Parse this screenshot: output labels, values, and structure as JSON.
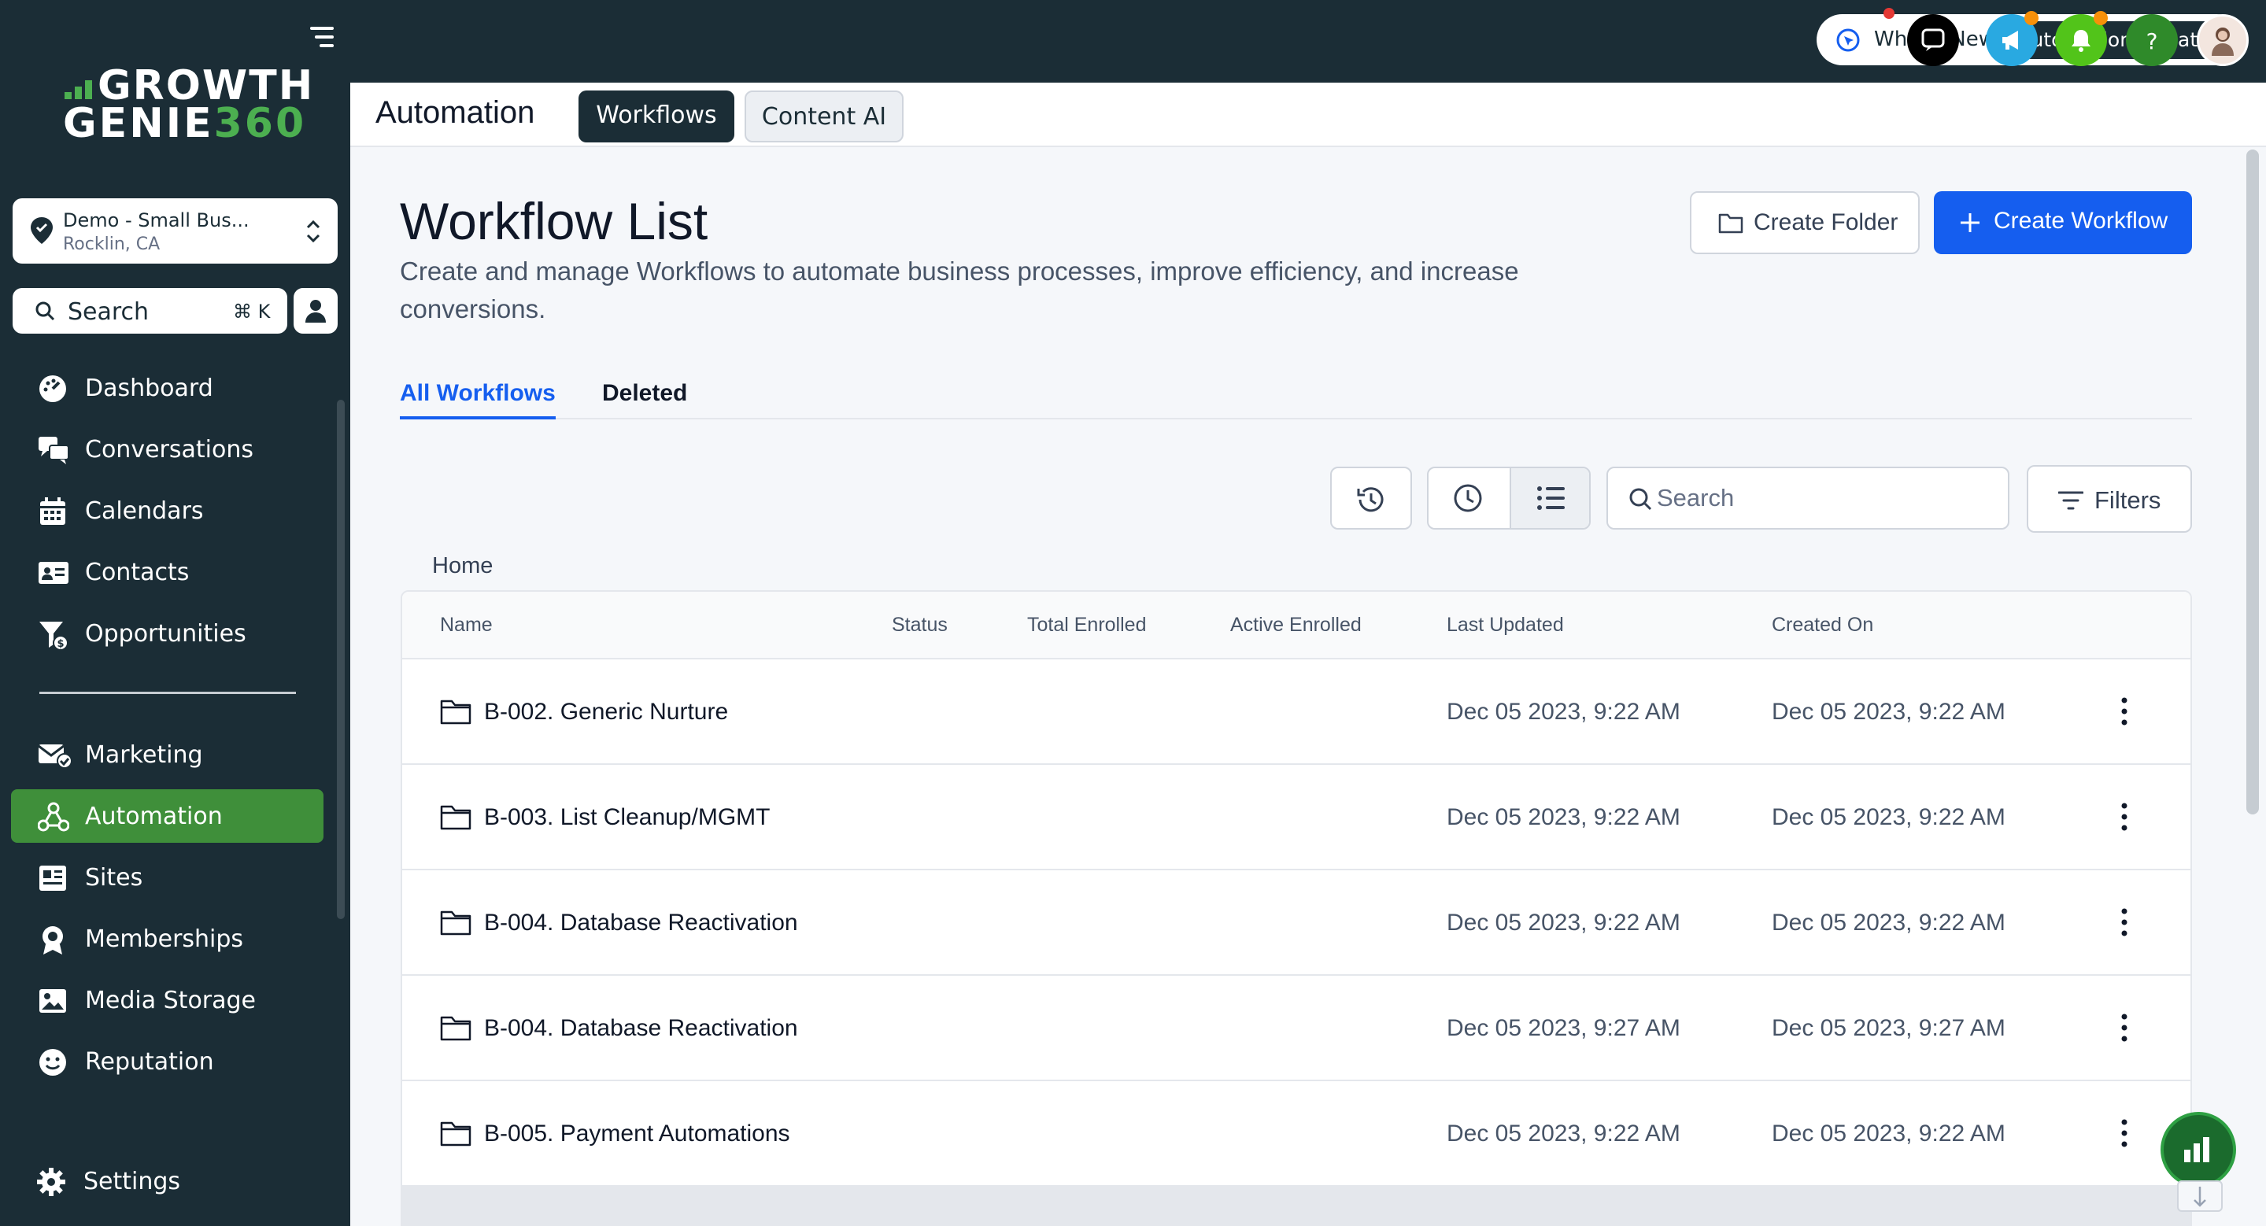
{
  "sidebar": {
    "logo": {
      "line1": "GROWTH",
      "line2a": "GENIE",
      "line2b": "360"
    },
    "location": {
      "name": "Demo - Small Bus...",
      "city": "Rocklin, CA"
    },
    "search": {
      "label": "Search",
      "shortcut": "⌘ K"
    },
    "items": [
      {
        "label": "Dashboard",
        "icon": "dashboard-icon"
      },
      {
        "label": "Conversations",
        "icon": "chat-icon"
      },
      {
        "label": "Calendars",
        "icon": "calendar-icon"
      },
      {
        "label": "Contacts",
        "icon": "contact-card-icon"
      },
      {
        "label": "Opportunities",
        "icon": "funnel-icon"
      },
      {
        "label": "Marketing",
        "icon": "mail-check-icon"
      },
      {
        "label": "Automation",
        "icon": "workflow-icon",
        "active": true
      },
      {
        "label": "Sites",
        "icon": "sites-icon"
      },
      {
        "label": "Memberships",
        "icon": "badge-icon"
      },
      {
        "label": "Media Storage",
        "icon": "image-icon"
      },
      {
        "label": "Reputation",
        "icon": "smiley-icon"
      },
      {
        "label": "Settings",
        "icon": "gear-icon"
      }
    ]
  },
  "topbar": {
    "whats_new": "What's New",
    "automation_updates": "Automation Updates"
  },
  "subheader": {
    "title": "Automation",
    "tabs": [
      {
        "label": "Workflows",
        "active": true
      },
      {
        "label": "Content AI",
        "active": false
      }
    ]
  },
  "page": {
    "title": "Workflow List",
    "description": "Create and manage Workflows to automate business processes, improve efficiency, and increase conversions.",
    "create_folder": "Create Folder",
    "create_workflow": "Create Workflow",
    "tabs": [
      {
        "label": "All Workflows",
        "selected": true
      },
      {
        "label": "Deleted",
        "selected": false
      }
    ],
    "search_placeholder": "Search",
    "filters": "Filters",
    "breadcrumb": "Home"
  },
  "table": {
    "columns": [
      "Name",
      "Status",
      "Total Enrolled",
      "Active Enrolled",
      "Last Updated",
      "Created On"
    ],
    "rows": [
      {
        "name": "B-002. Generic Nurture",
        "last_updated": "Dec 05 2023, 9:22 AM",
        "created_on": "Dec 05 2023, 9:22 AM"
      },
      {
        "name": "B-003. List Cleanup/MGMT",
        "last_updated": "Dec 05 2023, 9:22 AM",
        "created_on": "Dec 05 2023, 9:22 AM"
      },
      {
        "name": "B-004. Database Reactivation",
        "last_updated": "Dec 05 2023, 9:22 AM",
        "created_on": "Dec 05 2023, 9:22 AM"
      },
      {
        "name": "B-004. Database Reactivation",
        "last_updated": "Dec 05 2023, 9:27 AM",
        "created_on": "Dec 05 2023, 9:27 AM"
      },
      {
        "name": "B-005. Payment Automations",
        "last_updated": "Dec 05 2023, 9:22 AM",
        "created_on": "Dec 05 2023, 9:22 AM"
      }
    ]
  },
  "colors": {
    "sidebar_bg": "#1b2d36",
    "brand_green": "#4caf50",
    "active_nav": "#3f8f3a",
    "primary_blue": "#155eef"
  }
}
